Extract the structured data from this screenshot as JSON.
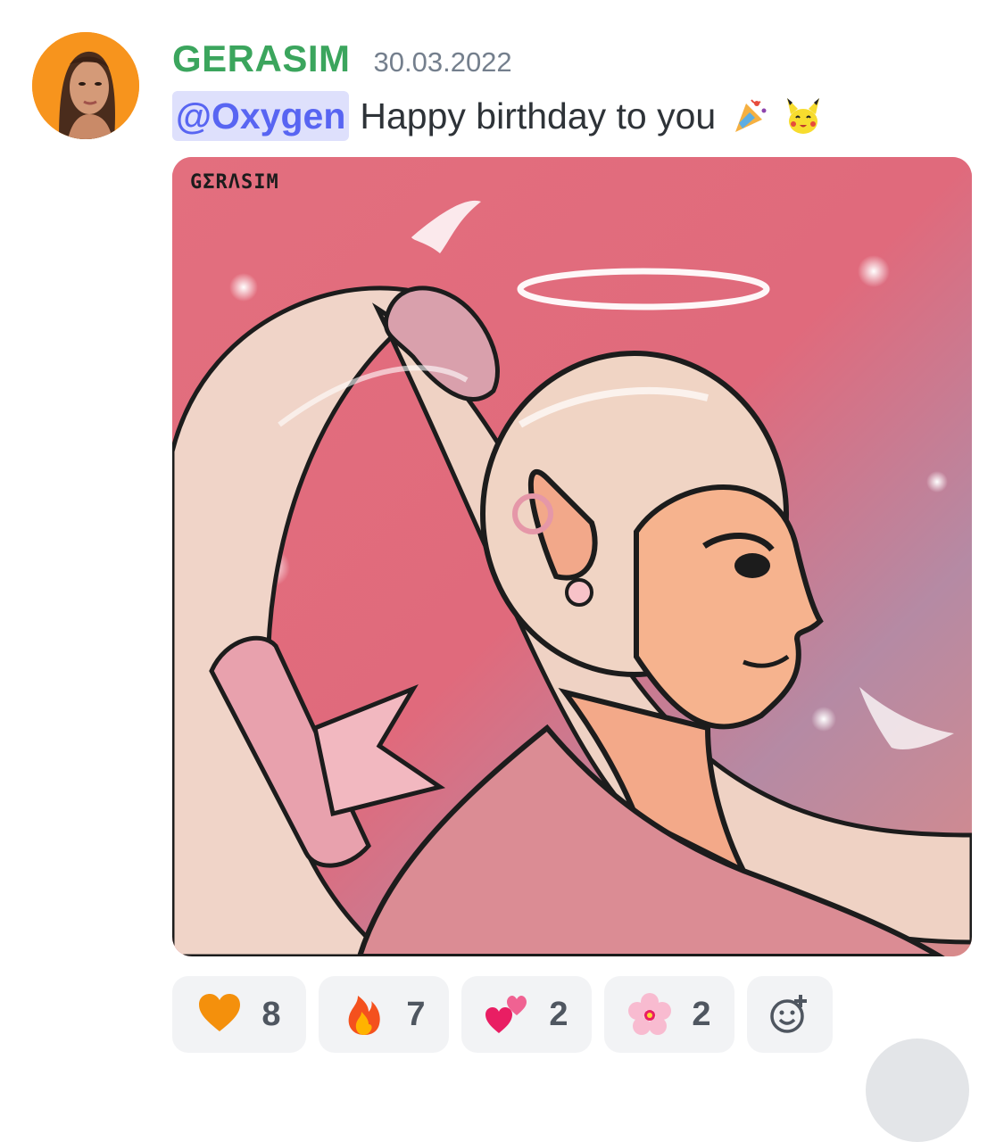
{
  "message": {
    "author": "GERASIM",
    "timestamp": "30.03.2022",
    "mention": "@Oxygen",
    "text": "Happy birthday to you",
    "inline_emojis": [
      "party-popper-icon",
      "pikachu-icon"
    ]
  },
  "attachment": {
    "type": "image",
    "signature": "GΣRΛSIM"
  },
  "reactions": [
    {
      "emoji": "orange-heart-icon",
      "count": "8"
    },
    {
      "emoji": "fire-icon",
      "count": "7"
    },
    {
      "emoji": "two-hearts-icon",
      "count": "2"
    },
    {
      "emoji": "cherry-blossom-icon",
      "count": "2"
    }
  ],
  "add_reaction": "add-reaction-icon",
  "colors": {
    "author": "#3ba55d",
    "mention_bg": "#dee0fc",
    "mention_text": "#5865f2",
    "reaction_bg": "#f2f3f5"
  }
}
